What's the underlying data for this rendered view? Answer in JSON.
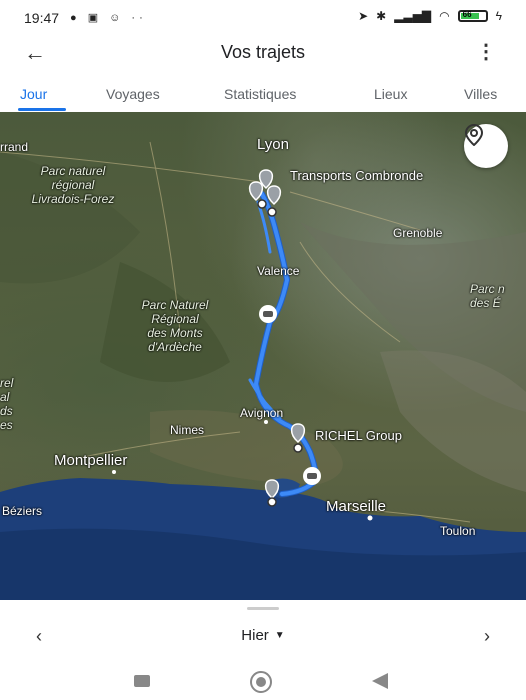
{
  "status_bar": {
    "time": "19:47",
    "battery": "66"
  },
  "header": {
    "title": "Vos trajets"
  },
  "tabs": [
    {
      "label": "Jour",
      "active": true
    },
    {
      "label": "Voyages",
      "active": false
    },
    {
      "label": "Statistiques",
      "active": false
    },
    {
      "label": "Lieux",
      "active": false
    },
    {
      "label": "Villes",
      "active": false
    }
  ],
  "map": {
    "labels": {
      "lyon": "Lyon",
      "transports": "Transports Combronde",
      "grenoble": "Grenoble",
      "valence": "Valence",
      "avignon": "Avignon",
      "nimes": "Nimes",
      "richel": "RICHEL Group",
      "montpellier": "Montpellier",
      "marseille": "Marseille",
      "toulon": "Toulon",
      "beziers": "Béziers",
      "rrand": "rrand",
      "parc_livradois_1": "Parc naturel",
      "parc_livradois_2": "régional",
      "parc_livradois_3": "Livradois-Forez",
      "parc_ardeche_1": "Parc Naturel",
      "parc_ardeche_2": "Régional",
      "parc_ardeche_3": "des Monts",
      "parc_ardeche_4": "d'Ardèche",
      "right_edge_1": "Parc n",
      "right_edge_2": "des É",
      "left_edge_1": "rel",
      "left_edge_2": "al",
      "left_edge_3": "ds",
      "left_edge_4": "es"
    },
    "route_color": "#3d8af7",
    "water_color": "#1d3f7a"
  },
  "bottom_sheet": {
    "day_label": "Hier"
  },
  "icons": {
    "back": "arrow-left-icon",
    "menu": "more-vert-icon",
    "locate": "location-pin-icon",
    "prev": "chevron-left-icon",
    "next": "chevron-right-icon"
  }
}
